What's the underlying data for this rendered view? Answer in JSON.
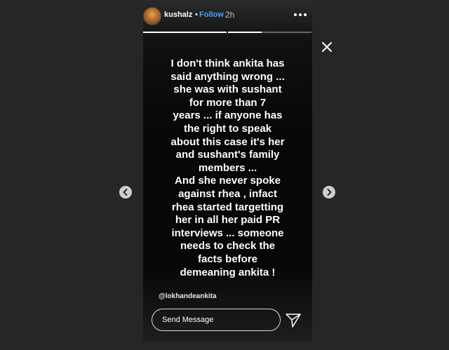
{
  "header": {
    "username": "kushalz",
    "separator": "•",
    "follow_label": "Follow",
    "time": "2h",
    "progress": [
      1,
      0.4,
      0
    ]
  },
  "story": {
    "text": "I don't think ankita has\nsaid anything wrong ...\nshe was with sushant\nfor more than 7\nyears ... if anyone has\nthe right to speak\nabout this case it's her\nand sushant's family\nmembers ...\nAnd she never spoke\nagainst rhea , infact\nrhea started targetting\nher in all her paid PR\ninterviews ... someone\nneeds to check the\nfacts before\ndemeaning ankita !",
    "mention": "@lokhandeankita"
  },
  "reply": {
    "placeholder": "Send Message"
  },
  "icons": {
    "more": "more-horizontal-icon",
    "close": "close-icon",
    "send": "paper-plane-icon",
    "prev": "chevron-left-icon",
    "next": "chevron-right-icon"
  }
}
